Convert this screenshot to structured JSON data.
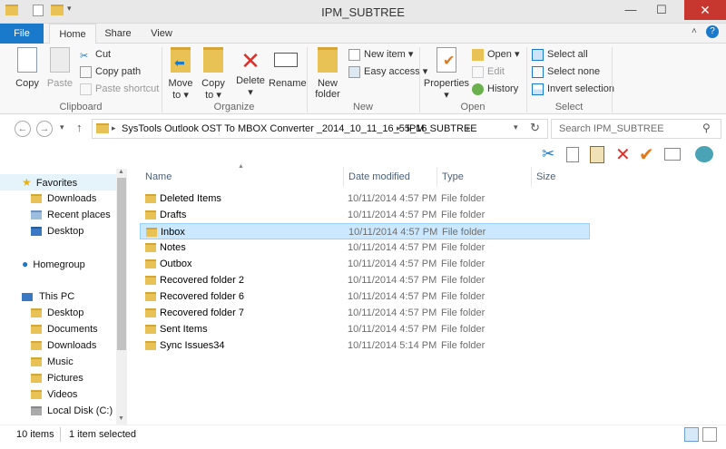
{
  "window": {
    "title": "IPM_SUBTREE",
    "minimize": "—",
    "maximize": "☐",
    "close": "✕"
  },
  "tabs": [
    {
      "label": "File"
    },
    {
      "label": "Home"
    },
    {
      "label": "Share"
    },
    {
      "label": "View"
    }
  ],
  "ribbon": {
    "clipboard": {
      "label": "Clipboard",
      "copy": "Copy",
      "paste": "Paste",
      "cut": "Cut",
      "copy_path": "Copy path",
      "paste_shortcut": "Paste shortcut"
    },
    "organize": {
      "label": "Organize",
      "move_to": "Move",
      "move_to_2": "to",
      "copy_to": "Copy",
      "copy_to_2": "to",
      "delete": "Delete",
      "rename": "Rename"
    },
    "new": {
      "label": "New",
      "new_folder": "New",
      "new_folder_2": "folder",
      "new_item": "New item",
      "easy_access": "Easy access"
    },
    "open": {
      "label": "Open",
      "properties": "Properties",
      "open": "Open",
      "edit": "Edit",
      "history": "History"
    },
    "select": {
      "label": "Select",
      "select_all": "Select all",
      "select_none": "Select none",
      "invert": "Invert selection"
    }
  },
  "address": {
    "crumbs": [
      "SysTools Outlook OST To MBOX Converter _2014_10_11_16_55_16",
      "IPM_SUBTREE"
    ],
    "search_placeholder": "Search IPM_SUBTREE"
  },
  "columns": {
    "name": "Name",
    "date": "Date modified",
    "type": "Type",
    "size": "Size"
  },
  "nav": {
    "favorites": "Favorites",
    "fav_items": [
      "Downloads",
      "Recent places",
      "Desktop"
    ],
    "homegroup": "Homegroup",
    "thispc": "This PC",
    "pc_items": [
      "Desktop",
      "Documents",
      "Downloads",
      "Music",
      "Pictures",
      "Videos",
      "Local Disk (C:)"
    ]
  },
  "files": [
    {
      "name": "Deleted Items",
      "date": "10/11/2014 4:57 PM",
      "type": "File folder"
    },
    {
      "name": "Drafts",
      "date": "10/11/2014 4:57 PM",
      "type": "File folder"
    },
    {
      "name": "Inbox",
      "date": "10/11/2014 4:57 PM",
      "type": "File folder",
      "selected": true
    },
    {
      "name": "Notes",
      "date": "10/11/2014 4:57 PM",
      "type": "File folder"
    },
    {
      "name": "Outbox",
      "date": "10/11/2014 4:57 PM",
      "type": "File folder"
    },
    {
      "name": "Recovered folder 2",
      "date": "10/11/2014 4:57 PM",
      "type": "File folder"
    },
    {
      "name": "Recovered folder 6",
      "date": "10/11/2014 4:57 PM",
      "type": "File folder"
    },
    {
      "name": "Recovered folder 7",
      "date": "10/11/2014 4:57 PM",
      "type": "File folder"
    },
    {
      "name": "Sent Items",
      "date": "10/11/2014 4:57 PM",
      "type": "File folder"
    },
    {
      "name": "Sync Issues34",
      "date": "10/11/2014 5:14 PM",
      "type": "File folder"
    }
  ],
  "status": {
    "count": "10 items",
    "selected": "1 item selected"
  },
  "colors": {
    "accent": "#1979ca",
    "selection": "#cce8ff",
    "folder": "#e8c254"
  }
}
